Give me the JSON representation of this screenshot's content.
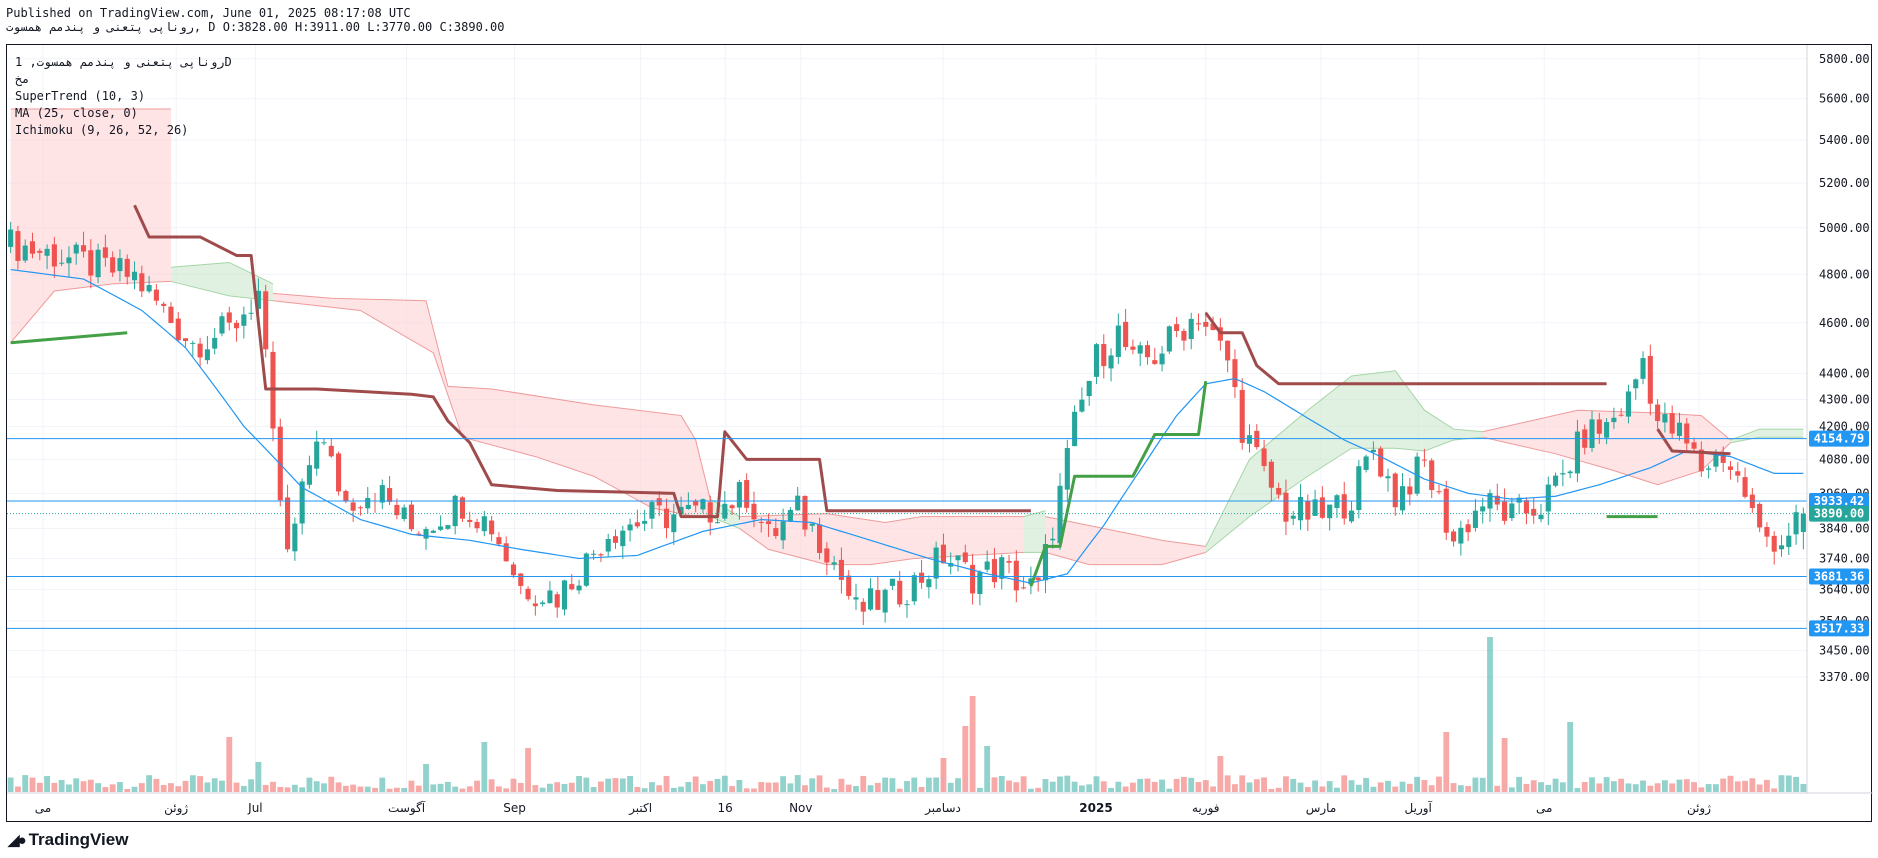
{
  "header": {
    "published": "Published on TradingView.com, June 01, 2025 08:17:08 UTC",
    "ohlc": "روناپی پتعنی و پندمم همسوت, D O:3828.00 H:3911.00 L:3770.00 C:3890.00"
  },
  "legend": {
    "symbol": "روناپی پتعنی و پندمم همسوت, 1D",
    "exchange": "مخ",
    "supertrend": "SuperTrend (10, 3)",
    "ma": "MA (25, close, 0)",
    "ichimoku": "Ichimoku (9, 26, 52, 26)"
  },
  "brand": {
    "logo_icon": "tradingview-logo-icon",
    "name": "TradingView"
  },
  "colors": {
    "up": "#26a69a",
    "down": "#ef5350",
    "supertrend_up": "#43a047",
    "supertrend_down": "#a04b4b",
    "ma": "#2196f3",
    "cloud_bull": "#c8e6c9",
    "cloud_bear": "#ffcdd2",
    "hline": "#2196f3",
    "close_line": "#26a69a"
  },
  "chart_data": {
    "type": "candlestick",
    "interval": "1D",
    "ohlc_last": {
      "open": 3828.0,
      "high": 3911.0,
      "low": 3770.0,
      "close": 3890.0
    },
    "y_scale": "log",
    "ylim": [
      3300,
      5850
    ],
    "y_ticks": [
      5800,
      5600,
      5400,
      5200,
      5000,
      4800,
      4600,
      4400,
      4300,
      4200,
      4080,
      3960,
      3840,
      3740,
      3640,
      3540,
      3450,
      3370
    ],
    "y_tick_labels": [
      "5800.00",
      "5600.00",
      "5400.00",
      "5200.00",
      "5000.00",
      "4800.00",
      "4600.00",
      "4400.00",
      "4300.00",
      "4200.00",
      "4080.00",
      "3960.00",
      "3840.00",
      "3740.00",
      "3640.00",
      "3540.00",
      "3450.00",
      "3370.00"
    ],
    "x_labels": [
      {
        "label": "می",
        "pos": 0.02
      },
      {
        "label": "ژوئن",
        "pos": 0.094
      },
      {
        "label": "Jul",
        "pos": 0.138
      },
      {
        "label": "آگوست",
        "pos": 0.222
      },
      {
        "label": "Sep",
        "pos": 0.282
      },
      {
        "label": "اکتبر",
        "pos": 0.352
      },
      {
        "label": "16",
        "pos": 0.399
      },
      {
        "label": "Nov",
        "pos": 0.441
      },
      {
        "label": "دسامبر",
        "pos": 0.52
      },
      {
        "label": "2025",
        "pos": 0.605
      },
      {
        "label": "فوریه",
        "pos": 0.666
      },
      {
        "label": "مارس",
        "pos": 0.73
      },
      {
        "label": "آوریل",
        "pos": 0.784
      },
      {
        "label": "می",
        "pos": 0.854
      },
      {
        "label": "ژوئن",
        "pos": 0.94
      }
    ],
    "horizontal_lines": [
      {
        "value": 4154.79,
        "label": "4154.79"
      },
      {
        "value": 3933.42,
        "label": "3933.42"
      },
      {
        "value": 3681.36,
        "label": "3681.36"
      },
      {
        "value": 3517.33,
        "label": "3517.33"
      }
    ],
    "last_close": {
      "value": 3890.0,
      "label": "3890.00"
    },
    "price_anchors": [
      [
        0,
        4930
      ],
      [
        10,
        4850
      ],
      [
        17,
        4790
      ],
      [
        22,
        4610
      ],
      [
        25,
        4520
      ],
      [
        30,
        4570
      ],
      [
        34,
        4720
      ],
      [
        36,
        4140
      ],
      [
        38,
        3740
      ],
      [
        40,
        3950
      ],
      [
        42,
        4180
      ],
      [
        46,
        3930
      ],
      [
        50,
        3980
      ],
      [
        55,
        3840
      ],
      [
        58,
        3870
      ],
      [
        62,
        3930
      ],
      [
        66,
        3850
      ],
      [
        70,
        3650
      ],
      [
        75,
        3620
      ],
      [
        79,
        3730
      ],
      [
        82,
        3830
      ],
      [
        88,
        3880
      ],
      [
        95,
        3890
      ],
      [
        101,
        3960
      ],
      [
        104,
        3810
      ],
      [
        108,
        3900
      ],
      [
        112,
        3780
      ],
      [
        116,
        3570
      ],
      [
        120,
        3610
      ],
      [
        124,
        3660
      ],
      [
        128,
        3750
      ],
      [
        132,
        3680
      ],
      [
        136,
        3710
      ],
      [
        139,
        3650
      ],
      [
        141,
        3640
      ],
      [
        144,
        3960
      ],
      [
        146,
        4200
      ],
      [
        149,
        4460
      ],
      [
        152,
        4560
      ],
      [
        154,
        4440
      ],
      [
        157,
        4470
      ],
      [
        160,
        4560
      ],
      [
        163,
        4640
      ],
      [
        165,
        4540
      ],
      [
        167,
        4450
      ],
      [
        169,
        4200
      ],
      [
        172,
        4020
      ],
      [
        175,
        3900
      ],
      [
        180,
        3880
      ],
      [
        184,
        3950
      ],
      [
        187,
        4120
      ],
      [
        190,
        3950
      ],
      [
        194,
        4060
      ],
      [
        198,
        3800
      ],
      [
        202,
        3930
      ],
      [
        206,
        3880
      ],
      [
        210,
        3920
      ],
      [
        213,
        4020
      ],
      [
        216,
        4170
      ],
      [
        219,
        4200
      ],
      [
        222,
        4300
      ],
      [
        224,
        4460
      ],
      [
        226,
        4220
      ],
      [
        229,
        4170
      ],
      [
        232,
        4050
      ],
      [
        235,
        4100
      ],
      [
        238,
        3960
      ],
      [
        240,
        3820
      ],
      [
        243,
        3800
      ],
      [
        246,
        3900
      ]
    ],
    "ma_anchors": [
      [
        0,
        4820
      ],
      [
        10,
        4780
      ],
      [
        18,
        4650
      ],
      [
        24,
        4500
      ],
      [
        32,
        4200
      ],
      [
        40,
        3980
      ],
      [
        48,
        3870
      ],
      [
        55,
        3820
      ],
      [
        63,
        3800
      ],
      [
        70,
        3770
      ],
      [
        78,
        3740
      ],
      [
        86,
        3750
      ],
      [
        95,
        3830
      ],
      [
        103,
        3870
      ],
      [
        110,
        3860
      ],
      [
        118,
        3800
      ],
      [
        126,
        3740
      ],
      [
        134,
        3690
      ],
      [
        140,
        3660
      ],
      [
        145,
        3690
      ],
      [
        150,
        3850
      ],
      [
        156,
        4080
      ],
      [
        160,
        4240
      ],
      [
        164,
        4360
      ],
      [
        168,
        4380
      ],
      [
        172,
        4330
      ],
      [
        178,
        4230
      ],
      [
        183,
        4150
      ],
      [
        188,
        4090
      ],
      [
        194,
        4010
      ],
      [
        200,
        3960
      ],
      [
        206,
        3940
      ],
      [
        212,
        3950
      ],
      [
        218,
        3990
      ],
      [
        225,
        4050
      ],
      [
        230,
        4110
      ],
      [
        236,
        4090
      ],
      [
        242,
        4030
      ]
    ],
    "supertrend_segments": [
      {
        "trend": "up",
        "points": [
          [
            0,
            4520
          ],
          [
            16,
            4560
          ]
        ]
      },
      {
        "trend": "down",
        "points": [
          [
            17,
            5100
          ],
          [
            19,
            4960
          ],
          [
            26,
            4960
          ],
          [
            31,
            4880
          ],
          [
            33,
            4880
          ],
          [
            35,
            4340
          ],
          [
            42,
            4340
          ],
          [
            55,
            4320
          ],
          [
            58,
            4310
          ],
          [
            60,
            4220
          ],
          [
            63,
            4140
          ],
          [
            66,
            3990
          ],
          [
            75,
            3970
          ],
          [
            91,
            3960
          ],
          [
            92,
            3880
          ],
          [
            97,
            3880
          ],
          [
            98,
            4180
          ],
          [
            101,
            4080
          ],
          [
            111,
            4080
          ],
          [
            112,
            3900
          ],
          [
            140,
            3900
          ]
        ]
      },
      {
        "trend": "up",
        "points": [
          [
            140,
            3650
          ],
          [
            142,
            3780
          ],
          [
            144,
            3780
          ],
          [
            146,
            4020
          ],
          [
            154,
            4020
          ],
          [
            157,
            4170
          ],
          [
            163,
            4170
          ],
          [
            164,
            4370
          ]
        ]
      },
      {
        "trend": "down",
        "points": [
          [
            164,
            4640
          ],
          [
            166,
            4560
          ],
          [
            169,
            4560
          ],
          [
            171,
            4430
          ],
          [
            174,
            4360
          ],
          [
            219,
            4360
          ]
        ]
      },
      {
        "trend": "up",
        "points": [
          [
            219,
            3880
          ],
          [
            226,
            3880
          ]
        ]
      },
      {
        "trend": "down",
        "points": [
          [
            226,
            4190
          ],
          [
            228,
            4110
          ],
          [
            236,
            4100
          ]
        ]
      }
    ],
    "cloud_segments": [
      {
        "type": "bear",
        "top": [
          [
            0,
            5550
          ],
          [
            22,
            5550
          ]
        ],
        "bottom": [
          [
            0,
            4520
          ],
          [
            6,
            4730
          ],
          [
            14,
            4760
          ],
          [
            22,
            4770
          ]
        ]
      },
      {
        "type": "bull",
        "top": [
          [
            22,
            4830
          ],
          [
            30,
            4850
          ],
          [
            36,
            4760
          ]
        ],
        "bottom": [
          [
            22,
            4770
          ],
          [
            30,
            4710
          ],
          [
            36,
            4690
          ]
        ]
      },
      {
        "type": "bear",
        "top": [
          [
            36,
            4720
          ],
          [
            44,
            4700
          ],
          [
            57,
            4690
          ],
          [
            60,
            4350
          ],
          [
            66,
            4340
          ],
          [
            80,
            4280
          ],
          [
            92,
            4240
          ],
          [
            94,
            4150
          ],
          [
            96,
            3940
          ]
        ],
        "bottom": [
          [
            36,
            4690
          ],
          [
            48,
            4650
          ],
          [
            58,
            4480
          ],
          [
            62,
            4160
          ],
          [
            72,
            4090
          ],
          [
            80,
            4020
          ],
          [
            88,
            3910
          ],
          [
            94,
            3880
          ],
          [
            96,
            3880
          ]
        ]
      },
      {
        "type": "bull",
        "top": [
          [
            96,
            3940
          ],
          [
            100,
            3880
          ]
        ],
        "bottom": [
          [
            96,
            3880
          ],
          [
            100,
            3840
          ]
        ]
      },
      {
        "type": "bear",
        "top": [
          [
            100,
            3880
          ],
          [
            112,
            3890
          ],
          [
            120,
            3860
          ],
          [
            125,
            3880
          ],
          [
            139,
            3880
          ]
        ],
        "bottom": [
          [
            100,
            3840
          ],
          [
            104,
            3770
          ],
          [
            112,
            3720
          ],
          [
            118,
            3720
          ],
          [
            124,
            3740
          ],
          [
            139,
            3760
          ]
        ]
      },
      {
        "type": "bull",
        "top": [
          [
            139,
            3880
          ],
          [
            142,
            3900
          ]
        ],
        "bottom": [
          [
            139,
            3760
          ],
          [
            142,
            3760
          ]
        ]
      },
      {
        "type": "bear",
        "top": [
          [
            142,
            3880
          ],
          [
            158,
            3800
          ],
          [
            164,
            3780
          ]
        ],
        "bottom": [
          [
            142,
            3760
          ],
          [
            148,
            3720
          ],
          [
            158,
            3720
          ],
          [
            164,
            3760
          ]
        ]
      },
      {
        "type": "bull",
        "top": [
          [
            164,
            3780
          ],
          [
            170,
            4080
          ],
          [
            178,
            4260
          ],
          [
            184,
            4390
          ],
          [
            190,
            4410
          ],
          [
            194,
            4260
          ],
          [
            198,
            4190
          ],
          [
            202,
            4180
          ]
        ],
        "bottom": [
          [
            164,
            3760
          ],
          [
            170,
            3880
          ],
          [
            178,
            4020
          ],
          [
            184,
            4120
          ],
          [
            190,
            4120
          ],
          [
            194,
            4110
          ],
          [
            198,
            4150
          ],
          [
            202,
            4160
          ]
        ]
      },
      {
        "type": "bear",
        "top": [
          [
            202,
            4180
          ],
          [
            215,
            4260
          ],
          [
            226,
            4250
          ],
          [
            232,
            4240
          ],
          [
            236,
            4150
          ]
        ],
        "bottom": [
          [
            202,
            4160
          ],
          [
            212,
            4100
          ],
          [
            220,
            4040
          ],
          [
            226,
            3990
          ],
          [
            232,
            4040
          ],
          [
            236,
            4140
          ]
        ]
      },
      {
        "type": "bull",
        "top": [
          [
            236,
            4150
          ],
          [
            240,
            4190
          ],
          [
            246,
            4190
          ]
        ],
        "bottom": [
          [
            236,
            4140
          ],
          [
            240,
            4160
          ],
          [
            246,
            4160
          ]
        ]
      }
    ],
    "volume_spikes": [
      [
        30,
        55
      ],
      [
        34,
        30
      ],
      [
        57,
        28
      ],
      [
        65,
        50
      ],
      [
        71,
        44
      ],
      [
        128,
        34
      ],
      [
        131,
        66
      ],
      [
        132,
        96
      ],
      [
        134,
        46
      ],
      [
        166,
        36
      ],
      [
        197,
        60
      ],
      [
        203,
        155
      ],
      [
        205,
        54
      ],
      [
        214,
        70
      ]
    ]
  }
}
